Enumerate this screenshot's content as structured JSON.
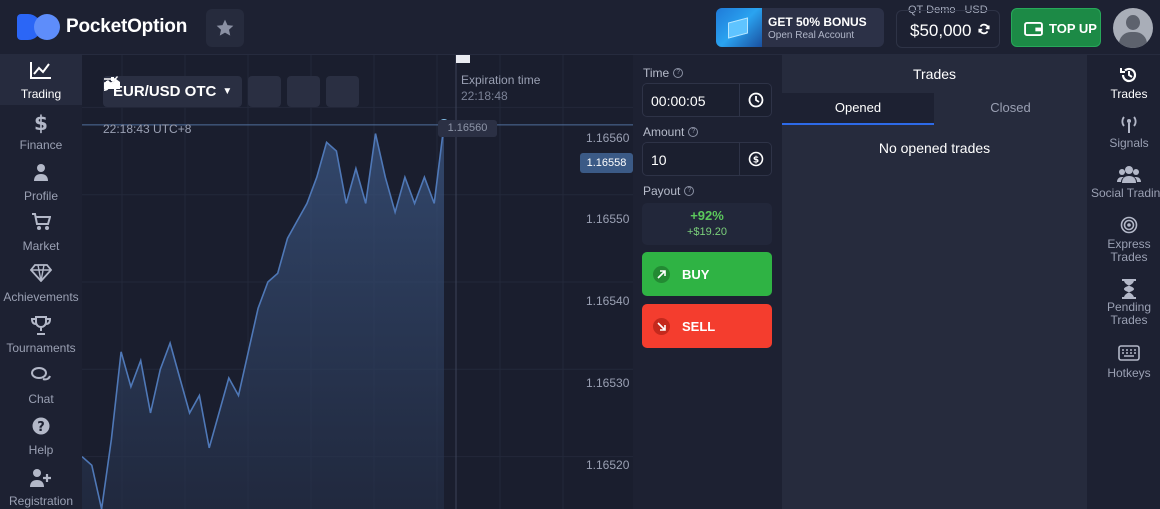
{
  "header": {
    "logo_text": "PocketOption",
    "bonus_title": "GET 50% BONUS",
    "bonus_subtitle": "Open Real Account",
    "account_type": "QT Demo",
    "currency": "USD",
    "balance": "$50,000",
    "topup_label": "TOP UP"
  },
  "left_nav": [
    {
      "label": "Trading",
      "icon": "chart-line-icon",
      "active": true
    },
    {
      "label": "Finance",
      "icon": "dollar-icon",
      "active": false
    },
    {
      "label": "Profile",
      "icon": "user-icon",
      "active": false
    },
    {
      "label": "Market",
      "icon": "cart-icon",
      "active": false
    },
    {
      "label": "Achievements",
      "icon": "diamond-icon",
      "active": false
    },
    {
      "label": "Tournaments",
      "icon": "trophy-icon",
      "active": false
    },
    {
      "label": "Chat",
      "icon": "chat-icon",
      "active": false
    },
    {
      "label": "Help",
      "icon": "help-icon",
      "active": false
    },
    {
      "label": "Registration",
      "icon": "add-user-icon",
      "active": false
    }
  ],
  "chart": {
    "pair": "EUR/USD OTC",
    "time": "22:18:43 UTC+8",
    "expiration_label": "Expiration time",
    "expiration_time": "22:18:48",
    "price_top_tag": "1.16560",
    "current_price": "1.16558",
    "price_ticks": [
      "1.16560",
      "1.16550",
      "1.16540",
      "1.16530",
      "1.16520"
    ],
    "line_color": "#4f78b7",
    "point_color": "#1ea2f0"
  },
  "chart_data": {
    "type": "area",
    "title": "",
    "xlabel": "",
    "ylabel": "",
    "ylim": [
      1.16514,
      1.16566
    ],
    "y_ticks": [
      1.1656,
      1.1655,
      1.1654,
      1.1653,
      1.1652
    ],
    "series": [
      {
        "name": "",
        "values": [
          1.1652,
          1.16519,
          1.16514,
          1.16522,
          1.16532,
          1.16528,
          1.16531,
          1.16525,
          1.1653,
          1.16533,
          1.16529,
          1.16525,
          1.16527,
          1.16521,
          1.16525,
          1.16529,
          1.16527,
          1.16532,
          1.16537,
          1.1654,
          1.16541,
          1.16545,
          1.16547,
          1.16549,
          1.16552,
          1.16556,
          1.16555,
          1.16549,
          1.16553,
          1.16549,
          1.16557,
          1.16552,
          1.16548,
          1.16552,
          1.16549,
          1.16552,
          1.16549,
          1.16558
        ]
      }
    ],
    "current_value": 1.16558
  },
  "order": {
    "time_label": "Time",
    "time_value": "00:00:05",
    "amount_label": "Amount",
    "amount_value": "10",
    "payout_label": "Payout",
    "payout_percent": "+92%",
    "payout_amount": "+$19.20",
    "buy_label": "BUY",
    "sell_label": "SELL"
  },
  "trades": {
    "title": "Trades",
    "tab_opened": "Opened",
    "tab_closed": "Closed",
    "empty_text": "No opened trades"
  },
  "right_nav": [
    {
      "label": "Trades",
      "icon": "history-icon",
      "active": true
    },
    {
      "label": "Signals",
      "icon": "signal-icon",
      "active": false
    },
    {
      "label": "Social Trading",
      "icon": "users-icon",
      "active": false
    },
    {
      "label": "Express Trades",
      "icon": "target-icon",
      "active": false
    },
    {
      "label": "Pending Trades",
      "icon": "hourglass-icon",
      "active": false
    },
    {
      "label": "Hotkeys",
      "icon": "keyboard-icon",
      "active": false
    }
  ]
}
